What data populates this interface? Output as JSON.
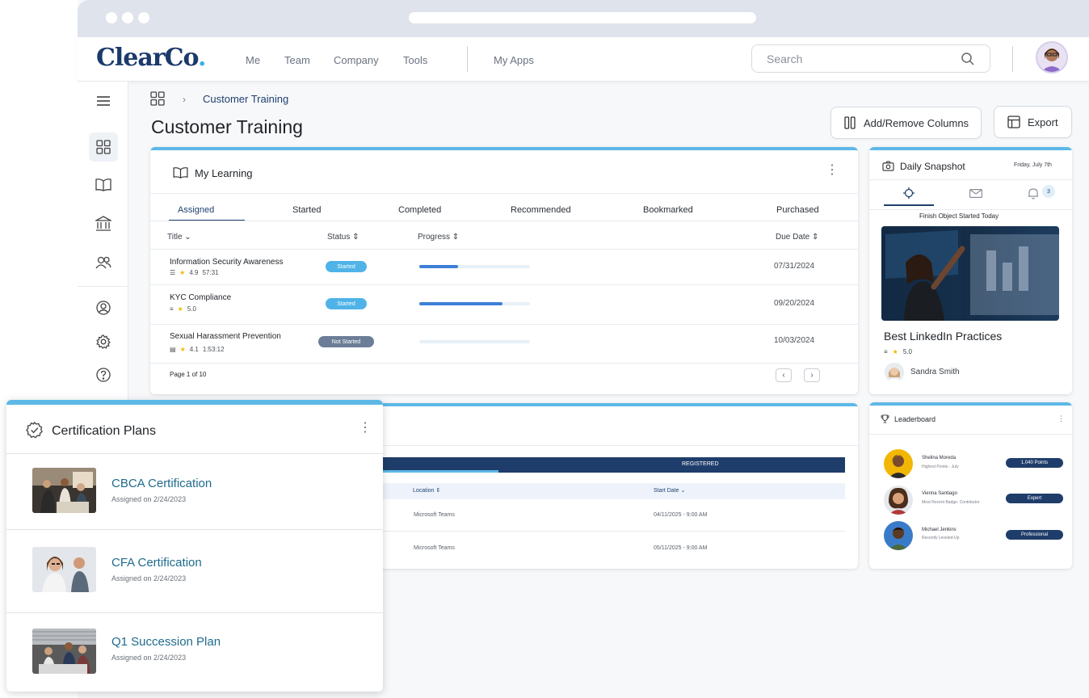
{
  "app": {
    "logo_main": "ClearCo",
    "logo_dot": "."
  },
  "nav": {
    "links": [
      "Me",
      "Team",
      "Company",
      "Tools"
    ],
    "my_apps": "My Apps"
  },
  "search": {
    "placeholder": "Search"
  },
  "breadcrumb": {
    "current": "Customer Training"
  },
  "page": {
    "title": "Customer Training"
  },
  "toolbar": {
    "columns_label": "Add/Remove Columns",
    "export_label": "Export"
  },
  "my_learning": {
    "title": "My Learning",
    "tabs": [
      "Assigned",
      "Started",
      "Completed",
      "Recommended",
      "Bookmarked",
      "Purchased"
    ],
    "active_tab": "Assigned",
    "columns": [
      "Title",
      "Status",
      "Progress",
      "Due Date"
    ],
    "rows": [
      {
        "title": "Information Security Awareness",
        "rating": "4.9",
        "duration": "57:31",
        "status": "Started",
        "progress": 0.35,
        "due": "07/31/2024"
      },
      {
        "title": "KYC Compliance",
        "rating": "5.0",
        "duration": "",
        "status": "Started",
        "progress": 0.75,
        "due": "09/20/2024"
      },
      {
        "title": "Sexual Harassment Prevention",
        "rating": "4.1",
        "duration": "1:53:12",
        "status": "Not Started",
        "progress": 0.0,
        "due": "10/03/2024"
      }
    ],
    "pagination": "Page 1 of 10"
  },
  "snapshot": {
    "title": "Daily Snapshot",
    "date": "Friday, July 7th",
    "notif_count": "3",
    "subtitle": "Finish Object Started Today",
    "course_title": "Best LinkedIn Practices",
    "rating": "5.0",
    "author": "Sandra Smith"
  },
  "events": {
    "registered_label": "REGISTERED",
    "columns": [
      "Location",
      "Start Date"
    ],
    "rows": [
      {
        "location": "Microsoft Teams",
        "start": "04/11/2025 - 9:00 AM"
      },
      {
        "location": "Microsoft Teams",
        "start": "05/11/2025 - 9:00 AM"
      }
    ]
  },
  "leaderboard": {
    "title": "Leaderboard",
    "entries": [
      {
        "name": "Shelina Moreda",
        "sub": "Highest Points - July",
        "badge": "1,040 Points"
      },
      {
        "name": "Vienna Santiago",
        "sub": "Most Recent Badge: Contributor",
        "badge": "Expert"
      },
      {
        "name": "Michael Jenkins",
        "sub": "Recently Leveled-Up",
        "badge": "Professional"
      }
    ]
  },
  "certification": {
    "title": "Certification Plans",
    "items": [
      {
        "title": "CBCA Certification",
        "assigned": "Assigned on 2/24/2023"
      },
      {
        "title": "CFA Certification",
        "assigned": "Assigned on 2/24/2023"
      },
      {
        "title": "Q1 Succession Plan",
        "assigned": "Assigned on 2/24/2023"
      }
    ]
  },
  "colors": {
    "accent": "#5db8e6",
    "brand": "#1a3a6b",
    "started": "#4fb3e8",
    "not_started": "#6b7d97",
    "progress": "#3d7fd6"
  }
}
